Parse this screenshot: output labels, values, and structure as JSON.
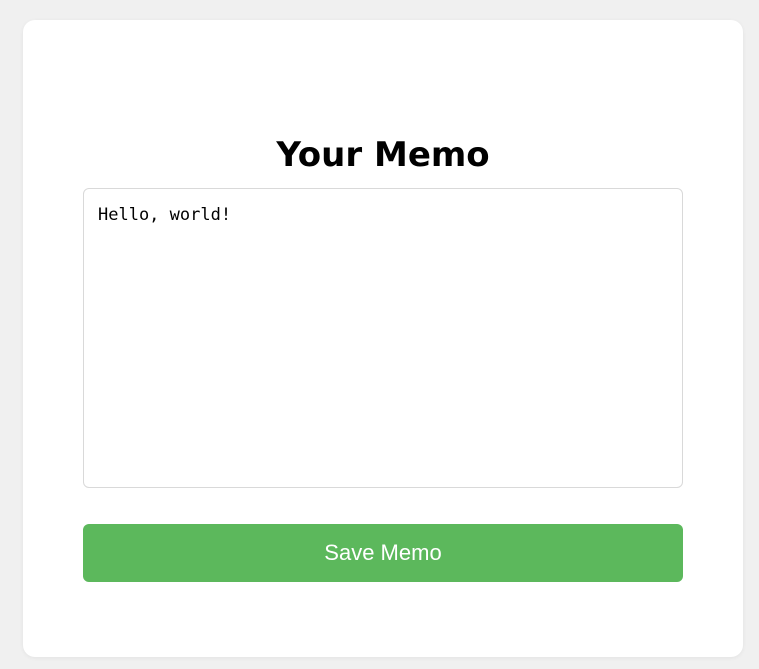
{
  "memo": {
    "title": "Your Memo",
    "text_value": "Hello, world!",
    "save_label": "Save Memo"
  },
  "colors": {
    "page_background": "#f0f0f0",
    "card_background": "#ffffff",
    "button_background": "#5cb85c",
    "button_text": "#ffffff",
    "input_border": "#d9d9d9"
  }
}
